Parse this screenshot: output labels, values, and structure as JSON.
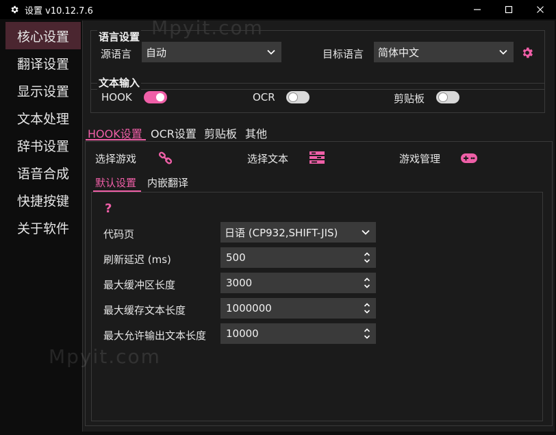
{
  "window": {
    "title": "设置 v10.12.7.6"
  },
  "sidebar": {
    "items": [
      {
        "label": "核心设置"
      },
      {
        "label": "翻译设置"
      },
      {
        "label": "显示设置"
      },
      {
        "label": "文本处理"
      },
      {
        "label": "辞书设置"
      },
      {
        "label": "语音合成"
      },
      {
        "label": "快捷按键"
      },
      {
        "label": "关于软件"
      }
    ],
    "active_index": 0
  },
  "language": {
    "group_title": "语言设置",
    "source_label": "源语言",
    "source_value": "自动",
    "target_label": "目标语言",
    "target_value": "简体中文"
  },
  "text_input": {
    "group_title": "文本输入",
    "hook_label": "HOOK",
    "hook_on": true,
    "ocr_label": "OCR",
    "ocr_on": false,
    "clipboard_label": "剪贴板",
    "clipboard_on": false
  },
  "tabs": [
    {
      "label": "HOOK设置"
    },
    {
      "label": "OCR设置"
    },
    {
      "label": "剪贴板"
    },
    {
      "label": "其他"
    }
  ],
  "hook": {
    "select_game_label": "选择游戏",
    "select_text_label": "选择文本",
    "game_manage_label": "游戏管理",
    "subtabs": [
      {
        "label": "默认设置"
      },
      {
        "label": "内嵌翻译"
      }
    ],
    "help_glyph": "?",
    "fields": [
      {
        "label": "代码页",
        "value": "日语 (CP932,SHIFT-JIS)",
        "kind": "select"
      },
      {
        "label": "刷新延迟 (ms)",
        "value": "500",
        "kind": "spin"
      },
      {
        "label": "最大缓冲区长度",
        "value": "3000",
        "kind": "spin"
      },
      {
        "label": "最大缓存文本长度",
        "value": "1000000",
        "kind": "spin"
      },
      {
        "label": "最大允许输出文本长度",
        "value": "10000",
        "kind": "spin"
      }
    ]
  },
  "watermarks": [
    "Mpyit.com",
    "Mpyit.com"
  ],
  "colors": {
    "accent": "#ef5fa7",
    "sidebar_active": "#4b2630",
    "background": "#1b1b1b"
  }
}
